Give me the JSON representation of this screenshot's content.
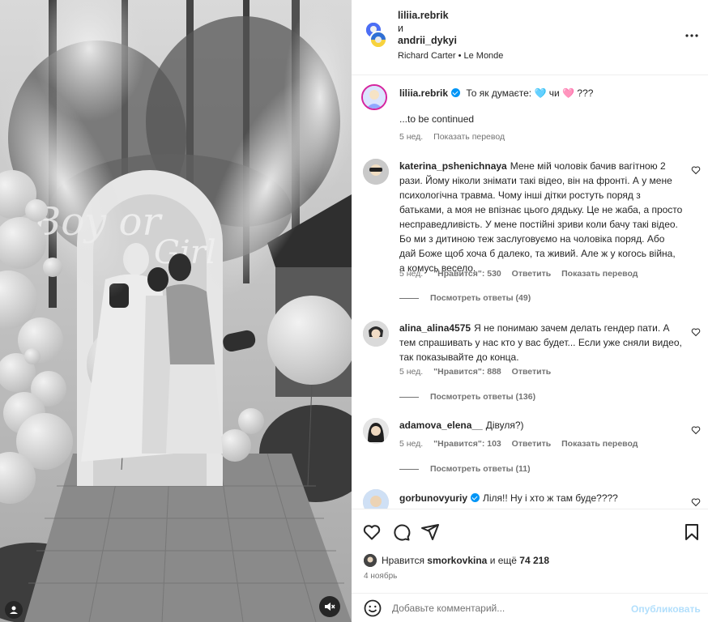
{
  "header": {
    "user1": "liliia.rebrik",
    "and": "и",
    "user2": "andrii_dykyi",
    "audio": "Richard Carter • Le Monde"
  },
  "caption": {
    "user": "liliia.rebrik",
    "text_before": "То як думаєте:",
    "heart1": "🩵",
    "mid": "чи",
    "heart2": "🩷",
    "text_after": "???",
    "line2": "...to be continued",
    "time": "5 нед.",
    "translate": "Показать перевод"
  },
  "comments": [
    {
      "user": "katerina_pshenichnaya",
      "text": "Мене мій чоловік бачив вагітною 2 рази. Йому ніколи знімати такі відео, він на фронті. А у мене психологічна травма. Чому інші дітки ростуть поряд з батьками, а моя не впізнає цього дядьку. Це не жаба, а просто несправедливість. У мене постійні зриви коли бачу такі відео. Бо ми з дитиною теж заслуговуємо на чоловіка поряд. Або дай Боже щоб хоча б далеко, та живий. Але ж у когось війна, а комусь весело.",
      "time": "5 нед.",
      "likes": "\"Нравится\": 530",
      "reply": "Ответить",
      "translate": "Показать перевод",
      "view_replies": "Посмотреть ответы (49)"
    },
    {
      "user": "alina_alina4575",
      "text": "Я не понимаю зачем делать гендер пати. А тем спрашивать у нас кто у вас будет... Если уже сняли видео, так показывайте до конца.",
      "time": "5 нед.",
      "likes": "\"Нравится\": 888",
      "reply": "Ответить",
      "view_replies": "Посмотреть ответы (136)"
    },
    {
      "user": "adamova_elena__",
      "text": "Дівуля?)",
      "time": "5 нед.",
      "likes": "\"Нравится\": 103",
      "reply": "Ответить",
      "translate": "Показать перевод",
      "view_replies": "Посмотреть ответы (11)"
    },
    {
      "user": "gorbunovyuriy",
      "text": "Ліля!! Ну і хто ж там буде????"
    }
  ],
  "likes": {
    "prefix": "Нравится",
    "user": "smorkovkina",
    "middle": "и ещё",
    "count": "74 218"
  },
  "date": "4 ноябрь",
  "composer": {
    "placeholder": "Добавьте комментарий...",
    "post_label": "Опубликовать"
  },
  "colors": {
    "verified": "#0095f6",
    "muted_text": "#737373",
    "post_disabled": "#b2dffc"
  },
  "icons": [
    "more-icon",
    "heart-icon",
    "comment-icon",
    "share-icon",
    "bookmark-icon",
    "emoji-icon",
    "mute-icon",
    "verified-icon"
  ]
}
